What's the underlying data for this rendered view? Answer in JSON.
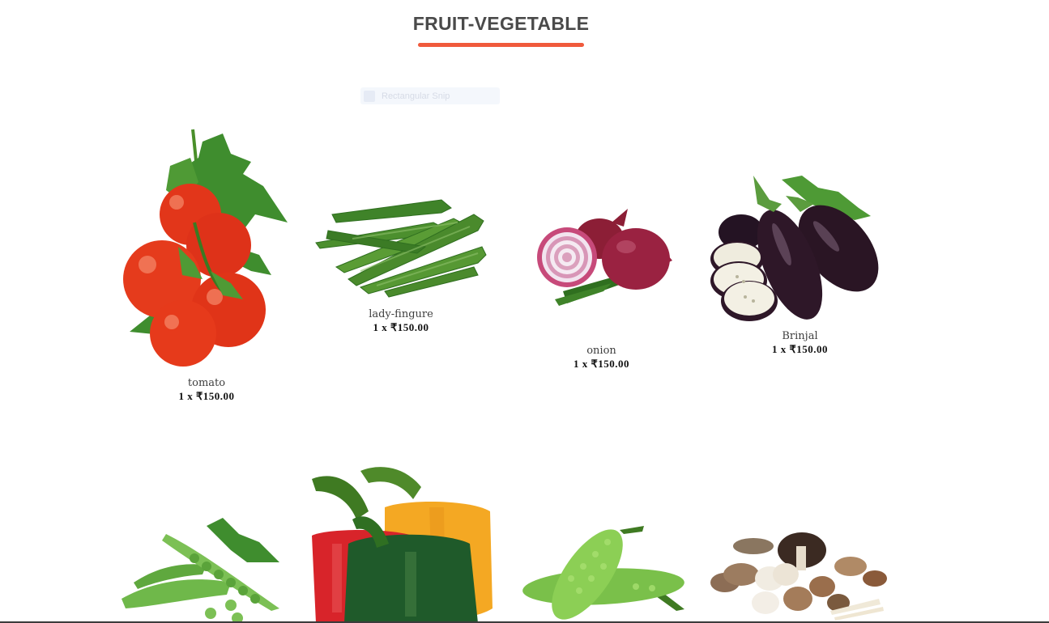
{
  "section": {
    "title": "FRUIT-VEGETABLE",
    "accent_color": "#f05a3c"
  },
  "ghost_tag": {
    "label": "Rectangular Snip"
  },
  "products": [
    {
      "name": "tomato",
      "price": "1 x ₹150.00",
      "icon": "tomato-image"
    },
    {
      "name": "lady-fingure",
      "price": "1 x ₹150.00",
      "icon": "okra-image"
    },
    {
      "name": "onion",
      "price": "1 x ₹150.00",
      "icon": "onion-image"
    },
    {
      "name": "Brinjal",
      "price": "1 x ₹150.00",
      "icon": "brinjal-image"
    }
  ],
  "products_row2": [
    {
      "icon": "peas-image"
    },
    {
      "icon": "bell-pepper-image"
    },
    {
      "icon": "bitter-gourd-image"
    },
    {
      "icon": "mushroom-image"
    }
  ]
}
